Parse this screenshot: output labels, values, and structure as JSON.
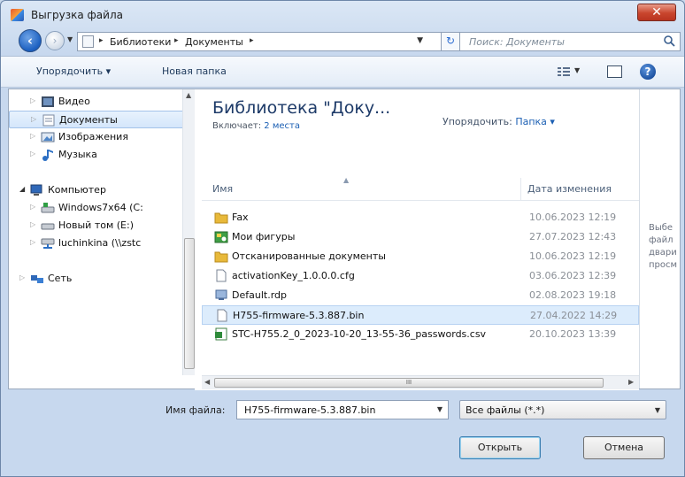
{
  "window": {
    "title": "Выгрузка файла",
    "close_label": "✕"
  },
  "address_bar": {
    "crumbs": [
      "Библиотеки",
      "Документы"
    ],
    "separator": "▸",
    "refresh_glyph": "↻"
  },
  "search": {
    "placeholder": "Поиск: Документы"
  },
  "toolbar": {
    "organize_label": "Упорядочить ▾",
    "new_folder_label": "Новая папка"
  },
  "nav_pane": {
    "items": [
      {
        "label": "Видео",
        "icon": "video-icon"
      },
      {
        "label": "Документы",
        "icon": "documents-icon",
        "selected": true
      },
      {
        "label": "Изображения",
        "icon": "pictures-icon"
      },
      {
        "label": "Музыка",
        "icon": "music-icon"
      },
      {
        "label": "Компьютер",
        "icon": "computer-icon"
      },
      {
        "label": "Windows7x64 (C:",
        "icon": "drive-icon"
      },
      {
        "label": "Новый том (E:)",
        "icon": "drive-icon"
      },
      {
        "label": "luchinkina (\\\\zstc",
        "icon": "network-drive-icon"
      },
      {
        "label": "Сеть",
        "icon": "network-icon"
      }
    ]
  },
  "library": {
    "title": "Библиотека \"Доку...",
    "includes_label": "Включает:",
    "includes_link": "2 места",
    "arrange_label": "Упорядочить:",
    "arrange_value": "Папка ▾"
  },
  "columns": {
    "name": "Имя",
    "date": "Дата изменения"
  },
  "files": [
    {
      "name": "Fax",
      "date": "10.06.2023 12:19",
      "type": "folder"
    },
    {
      "name": "Мои фигуры",
      "date": "27.07.2023 12:43",
      "type": "shapes-folder"
    },
    {
      "name": "Отсканированные документы",
      "date": "10.06.2023 12:19",
      "type": "folder"
    },
    {
      "name": "activationKey_1.0.0.0.cfg",
      "date": "03.06.2023 12:39",
      "type": "file"
    },
    {
      "name": "Default.rdp",
      "date": "02.08.2023 19:18",
      "type": "rdp"
    },
    {
      "name": "H755-firmware-5.3.887.bin",
      "date": "27.04.2022 14:29",
      "type": "file",
      "selected": true
    },
    {
      "name": "STC-H755.2_0_2023-10-20_13-55-36_passwords.csv",
      "date": "20.10.2023 13:39",
      "type": "csv"
    }
  ],
  "preview": {
    "text": "Выбе\nфайл\nдвари\nпросм"
  },
  "bottom": {
    "filename_label": "Имя файла:",
    "filename_value": "H755-firmware-5.3.887.bin",
    "filter_value": "Все файлы (*.*)",
    "open_label": "Открыть",
    "cancel_label": "Отмена"
  },
  "colors": {
    "accent": "#1b5fb3",
    "selection": "#dcecfc",
    "close": "#c9452d"
  }
}
